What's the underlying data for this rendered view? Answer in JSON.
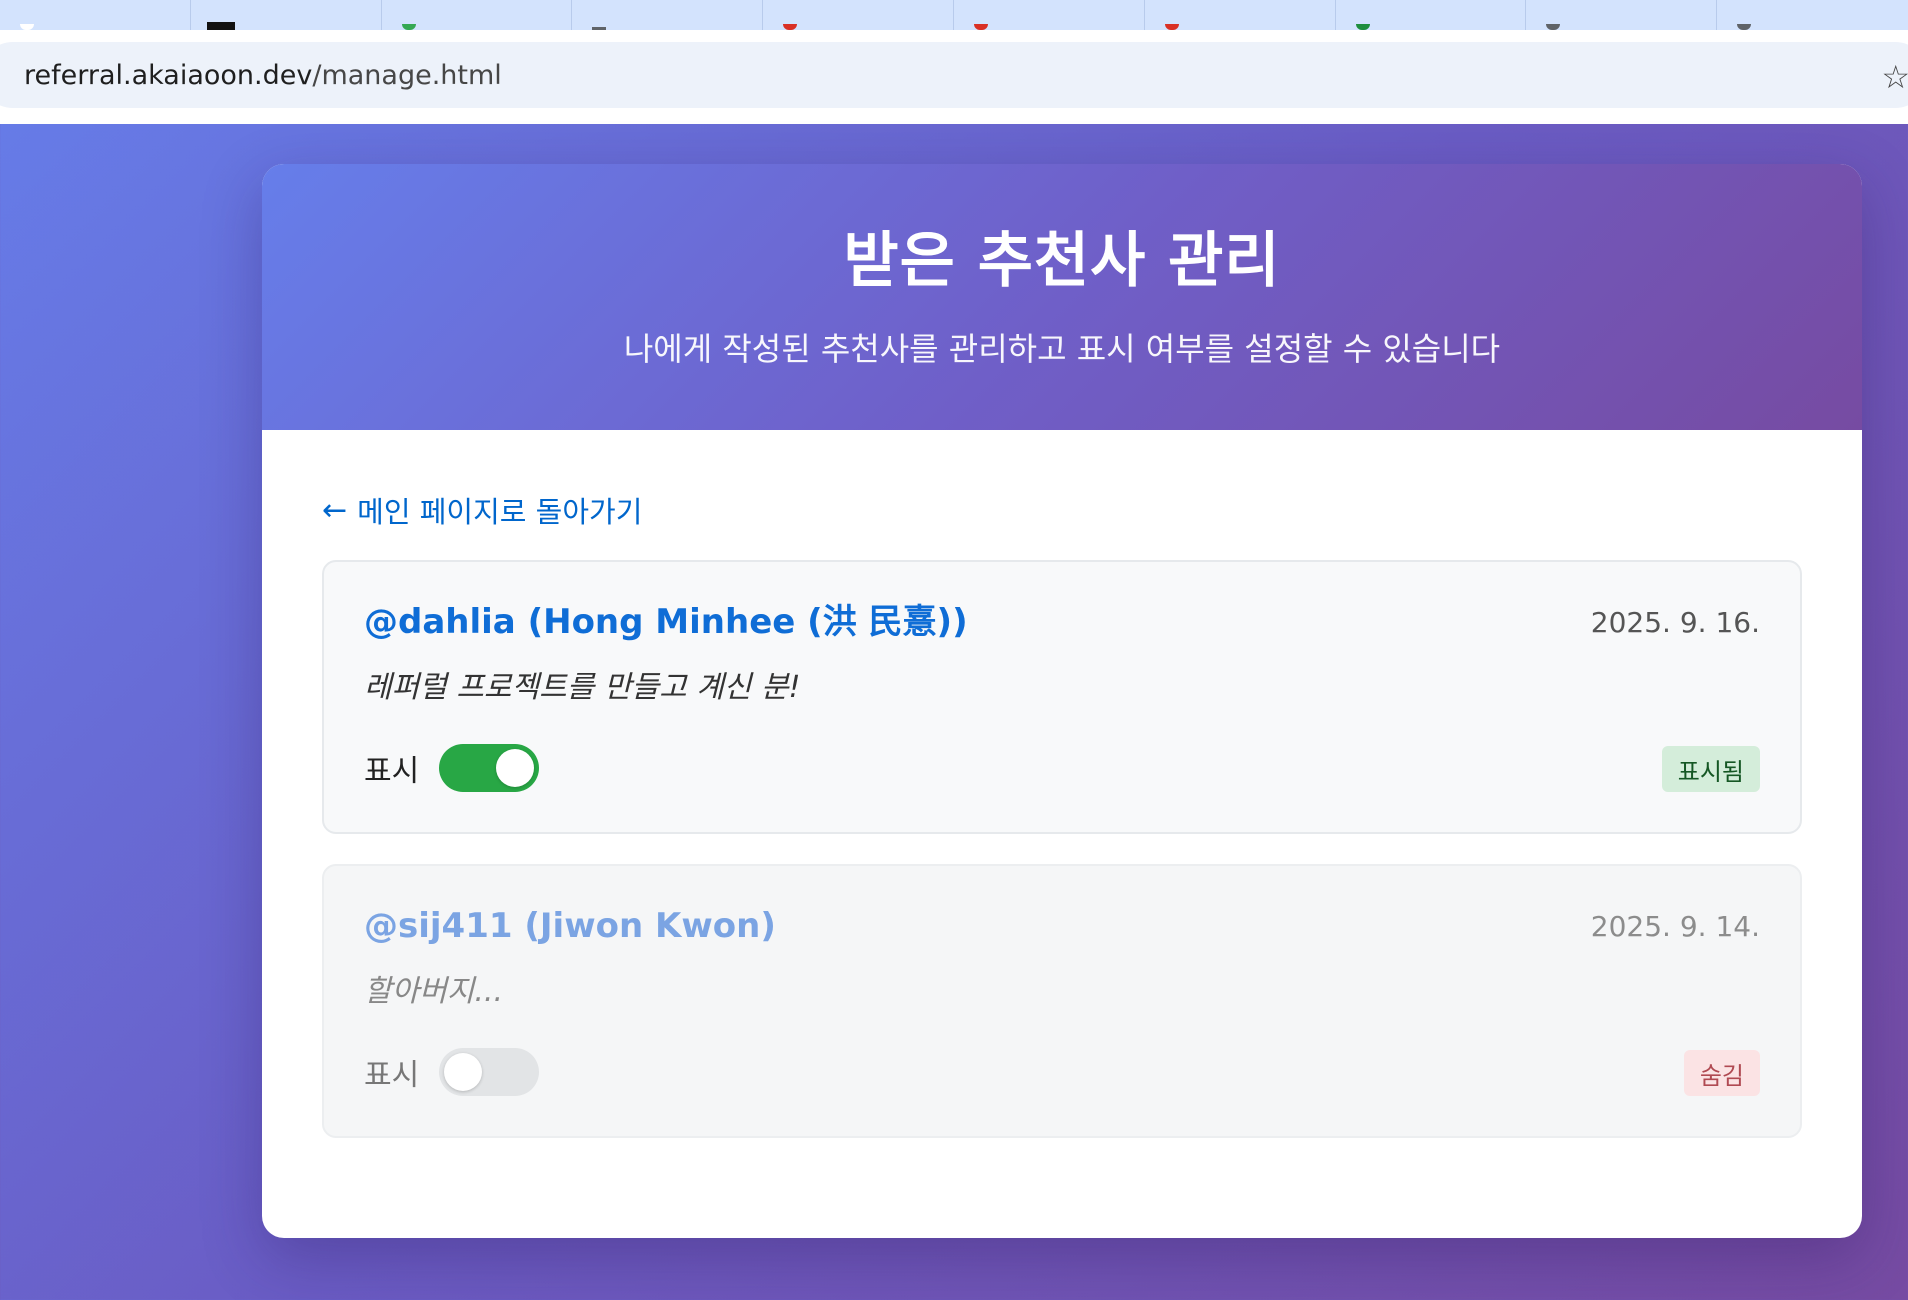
{
  "browser": {
    "url_host": "referral.akaiaoon.dev",
    "url_path": "/manage.html",
    "tab_favicon_colors": [
      "#ffffff",
      "#111111",
      "#34a853",
      "#5f6368",
      "#d93025",
      "#d93025",
      "#d93025",
      "#1e8e3e",
      "#5f6368",
      "#5f6368"
    ]
  },
  "header": {
    "title": "받은 추천사 관리",
    "subtitle": "나에게 작성된 추천사를 관리하고 표시 여부를 설정할 수 있습니다"
  },
  "back_link": {
    "arrow": "←",
    "label": "메인 페이지로 돌아가기"
  },
  "referrals": [
    {
      "author": "@dahlia (Hong Minhee (洪 民憙))",
      "date": "2025. 9. 16.",
      "message": "레퍼럴 프로젝트를 만들고 계신 분!",
      "toggle_label": "표시",
      "visible": true,
      "status": "표시됨"
    },
    {
      "author": "@sij411 (Jiwon Kwon)",
      "date": "2025. 9. 14.",
      "message": "할아버지...",
      "toggle_label": "표시",
      "visible": false,
      "status": "숨김"
    }
  ],
  "colors": {
    "accent": "#0f6dd6",
    "toggle_on": "#28a745",
    "toggle_off": "#e2e4e6",
    "badge_shown_bg": "#d4edda",
    "badge_hidden_bg": "#fbe3e4"
  }
}
